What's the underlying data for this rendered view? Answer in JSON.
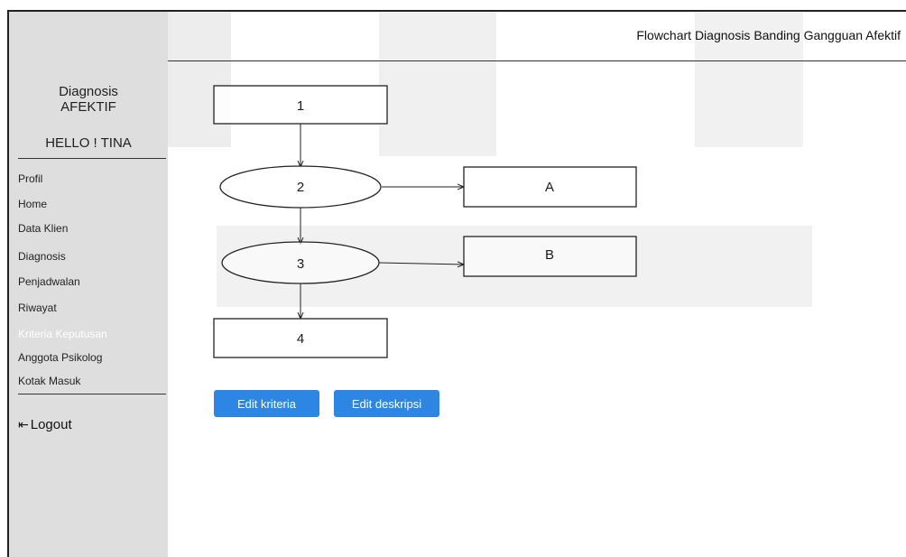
{
  "header": {
    "title": "Flowchart Diagnosis Banding Gangguan Afektif"
  },
  "sidebar": {
    "brand_line1": "Diagnosis",
    "brand_line2": "AFEKTIF",
    "greeting": "HELLO ! TINA",
    "items": [
      {
        "label": "Profil",
        "active": false
      },
      {
        "label": "Home",
        "active": false
      },
      {
        "label": "Data Klien",
        "active": false
      },
      {
        "label": "Diagnosis",
        "active": false
      },
      {
        "label": "Penjadwalan",
        "active": false
      },
      {
        "label": "Riwayat",
        "active": false
      },
      {
        "label": "Kriteria Keputusan",
        "active": true
      },
      {
        "label": "Anggota Psikolog",
        "active": false
      },
      {
        "label": "Kotak Masuk",
        "active": false
      }
    ],
    "logout_label": "Logout",
    "logout_icon": "logout-icon"
  },
  "flowchart": {
    "nodes": [
      {
        "id": "1",
        "label": "1",
        "shape": "rectangle"
      },
      {
        "id": "2",
        "label": "2",
        "shape": "ellipse"
      },
      {
        "id": "A",
        "label": "A",
        "shape": "rectangle"
      },
      {
        "id": "3",
        "label": "3",
        "shape": "ellipse"
      },
      {
        "id": "B",
        "label": "B",
        "shape": "rectangle"
      },
      {
        "id": "4",
        "label": "4",
        "shape": "rectangle"
      }
    ],
    "edges": [
      {
        "from": "1",
        "to": "2"
      },
      {
        "from": "2",
        "to": "A"
      },
      {
        "from": "2",
        "to": "3"
      },
      {
        "from": "3",
        "to": "B"
      },
      {
        "from": "3",
        "to": "4"
      }
    ]
  },
  "actions": {
    "edit_criteria_label": "Edit kriteria",
    "edit_description_label": "Edit deskripsi"
  },
  "colors": {
    "accent": "#2d86e4",
    "sidebar_bg": "#dedede",
    "active_item": "#ffffff"
  }
}
